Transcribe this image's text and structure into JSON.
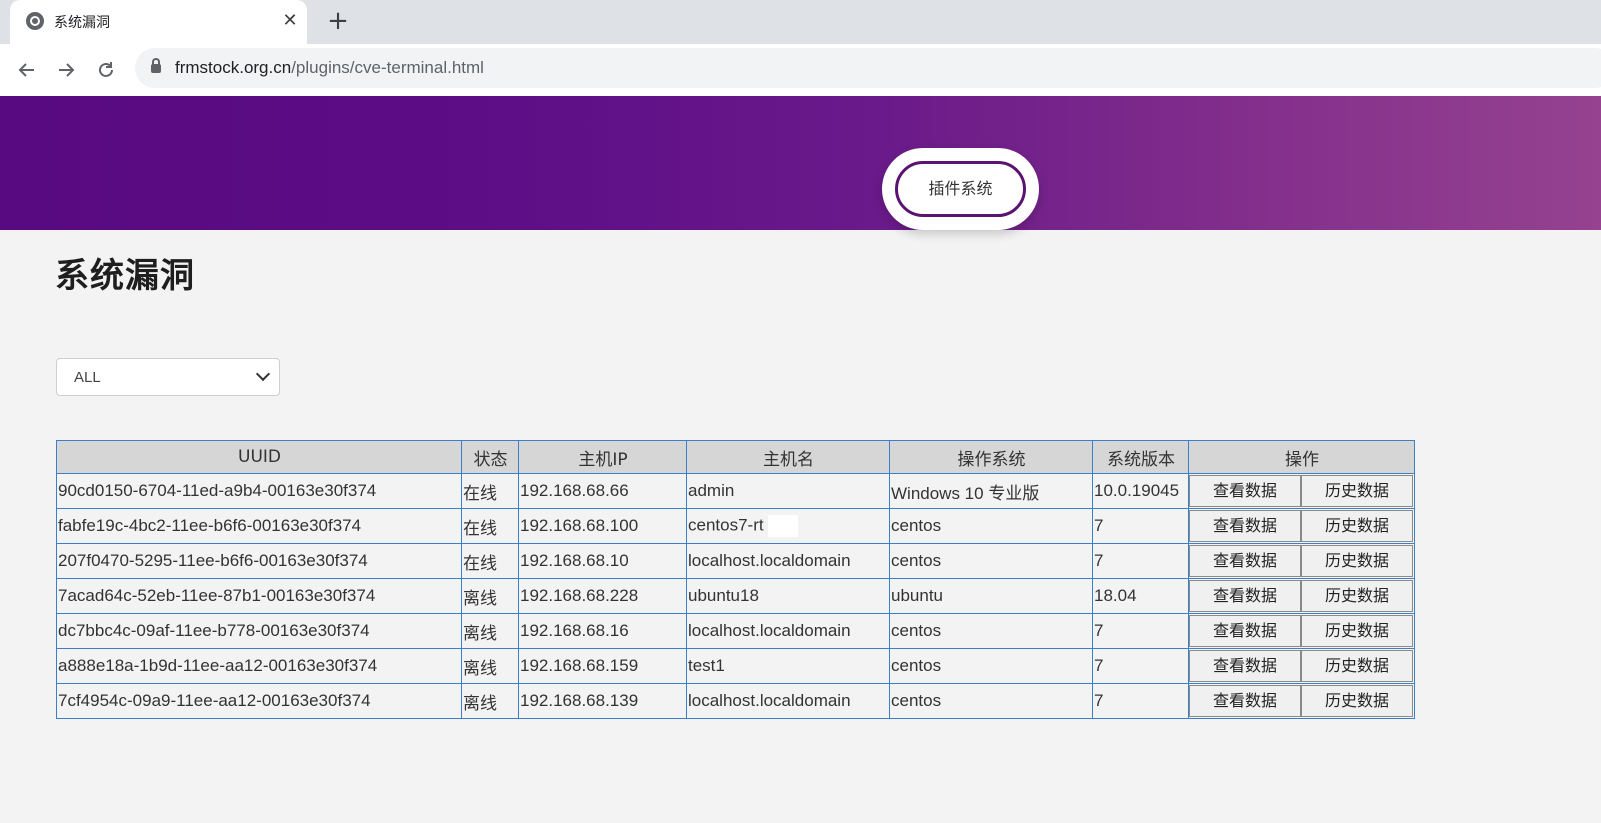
{
  "browser": {
    "tab_title": "系统漏洞",
    "tab_close": "✕",
    "new_tab": "+",
    "url_host": "frmstock.org.cn",
    "url_path": "/plugins/cve-terminal.html"
  },
  "header": {
    "plugin_button_label": "插件系统"
  },
  "page": {
    "title": "系统漏洞",
    "filter_value": "ALL"
  },
  "table": {
    "headers": [
      "UUID",
      "状态",
      "主机IP",
      "主机名",
      "操作系统",
      "系统版本",
      "操作"
    ],
    "view_label": "查看数据",
    "history_label": "历史数据",
    "rows": [
      {
        "uuid": "90cd0150-6704-11ed-a9b4-00163e30f374",
        "status": "在线",
        "ip": "192.168.68.66",
        "hostname": "admin",
        "os": "Windows 10 专业版",
        "version": "10.0.19045"
      },
      {
        "uuid": "fabfe19c-4bc2-11ee-b6f6-00163e30f374",
        "status": "在线",
        "ip": "192.168.68.100",
        "hostname": "centos7-rt",
        "os": "centos",
        "version": "7"
      },
      {
        "uuid": "207f0470-5295-11ee-b6f6-00163e30f374",
        "status": "在线",
        "ip": "192.168.68.10",
        "hostname": "localhost.localdomain",
        "os": "centos",
        "version": "7"
      },
      {
        "uuid": "7acad64c-52eb-11ee-87b1-00163e30f374",
        "status": "离线",
        "ip": "192.168.68.228",
        "hostname": "ubuntu18",
        "os": "ubuntu",
        "version": "18.04"
      },
      {
        "uuid": "dc7bbc4c-09af-11ee-b778-00163e30f374",
        "status": "离线",
        "ip": "192.168.68.16",
        "hostname": "localhost.localdomain",
        "os": "centos",
        "version": "7"
      },
      {
        "uuid": "a888e18a-1b9d-11ee-aa12-00163e30f374",
        "status": "离线",
        "ip": "192.168.68.159",
        "hostname": "test1",
        "os": "centos",
        "version": "7"
      },
      {
        "uuid": "7cf4954c-09a9-11ee-aa12-00163e30f374",
        "status": "离线",
        "ip": "192.168.68.139",
        "hostname": "localhost.localdomain",
        "os": "centos",
        "version": "7"
      }
    ]
  }
}
